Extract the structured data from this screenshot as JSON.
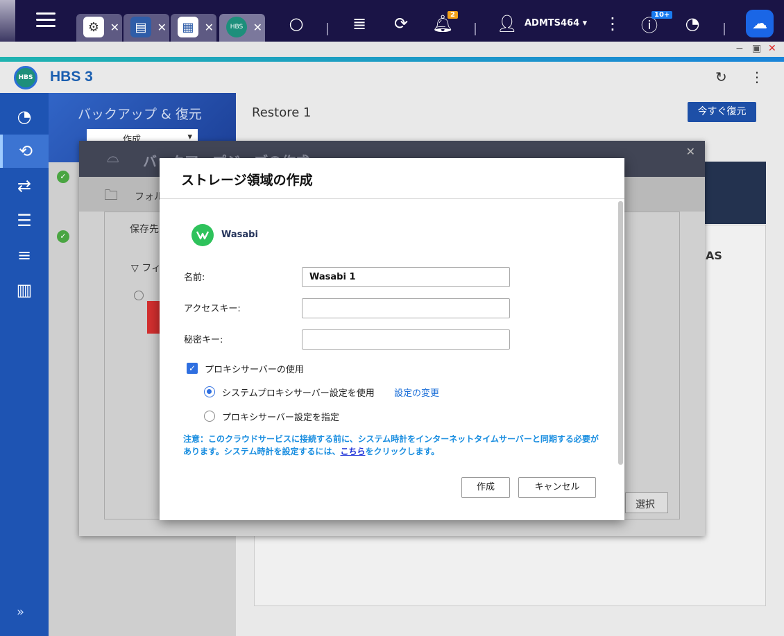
{
  "topbar": {
    "username": "ADMTS464",
    "notification_count": "2",
    "task_count": "10+"
  },
  "app": {
    "title": "HBS 3"
  },
  "left_panel": {
    "title": "バックアップ & 復元",
    "select_value": "作成"
  },
  "main": {
    "title": "Restore 1",
    "restore_now_label": "今すぐ復元"
  },
  "wizard": {
    "title": "バックアップジョブの作成",
    "subtitle": "フォルダー",
    "ghost_dest": "保存先",
    "ghost_filter": "フィ",
    "ghost_nas": "AS",
    "ghost_select": "選択"
  },
  "modal": {
    "title": "ストレージ領域の作成",
    "provider": "Wasabi",
    "fields": {
      "name_label": "名前:",
      "name_value": "Wasabi 1",
      "access_key_label": "アクセスキー:",
      "access_key_value": "",
      "secret_key_label": "秘密キー:",
      "secret_key_value": ""
    },
    "proxy": {
      "use_label": "プロキシサーバーの使用",
      "use_checked": true,
      "system_label": "システムプロキシサーバー設定を使用",
      "change_link": "設定の変更",
      "custom_label": "プロキシサーバー設定を指定"
    },
    "note_before": "注意：このクラウドサービスに接続する前に、システム時計をインターネットタイムサーバーと同期する必要があります。システム時計を設定するには、",
    "note_link": "こちら",
    "note_after": "をクリックします。",
    "create_label": "作成",
    "cancel_label": "キャンセル"
  }
}
